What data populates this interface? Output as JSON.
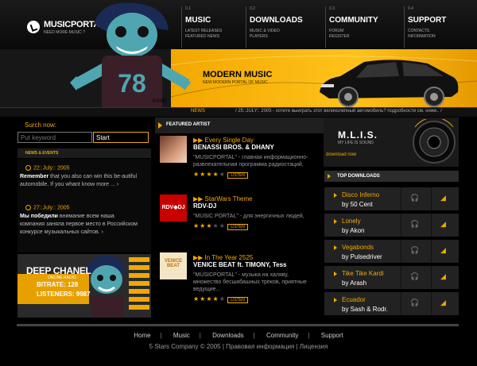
{
  "brand": {
    "name": "MUSICPORTAL",
    "tagline": "NEED MORE MUSIC ?"
  },
  "nav": [
    {
      "num": "0.1",
      "title": "MUSIC",
      "sub1": "LATEST RELEASES",
      "sub2": "FEATURED NEWS"
    },
    {
      "num": "0.2",
      "title": "DOWNLOADS",
      "sub1": "MUSIC & VIDEO",
      "sub2": "PLAYERS"
    },
    {
      "num": "0.3",
      "title": "COMMUNITY",
      "sub1": "FORUM",
      "sub2": "REGISTER"
    },
    {
      "num": "0.4",
      "title": "SUPPORT",
      "sub1": "CONTACTS",
      "sub2": "INFORMATION"
    }
  ],
  "banner": {
    "title": "MODERN MUSIC",
    "subtitle": "NEW MODERN PORTAL OF MUSIC",
    "brand_fragment": "RAND",
    "character_number": "78"
  },
  "news_ticker": {
    "label": "NEWS",
    "text": "/ 25::JULY:: 2005 - хотите выиграть этот великолепный автомобиль? подробности см. ниже.. /"
  },
  "search": {
    "label": "Surch now:",
    "placeholder": "Put keyword",
    "button": "Start"
  },
  "news_events": {
    "heading": "NEWS & EVENTS",
    "items": [
      {
        "date": "22::July:: 2005",
        "bold": "Remember",
        "text": " that you also can win this be-autiful automobile. If you whant know more ...",
        "more": "›"
      },
      {
        "date": "27::July:: 2005",
        "bold": "Мы победили",
        "text": " внимание всем наша компания заняла первое место в Российском конкурсе музыкальных сайтов.",
        "more": "›"
      }
    ]
  },
  "deep_channel": {
    "title": "DEEP CHANEL",
    "sub": "ONLINE RADIO",
    "bitrate": "BITRATE: 128",
    "listeners": "LISTENERS: 9987"
  },
  "featured": {
    "heading": "FEATURED ARTIST",
    "items": [
      {
        "title": "Every Single Day",
        "artist": "BENASSI BROS. & DHANY",
        "desc": "\"MUSICPORTAL\" - главная информационно-развлекательная программа радиостаций,",
        "rating": 4,
        "listen": "LISTEN",
        "img_label": ""
      },
      {
        "title": "StarWars Theme",
        "artist": "RDV-DJ",
        "desc": "\"MUSIC PORTAL\" - для энергичных людей,",
        "rating": 3,
        "listen": "LISTEN",
        "img_label": "RDV◆DJ"
      },
      {
        "title": "In The Year 2525",
        "artist": "VENICE BEAT ft. TIMONY, Tess",
        "desc": "\"MUSICPORTAL\" - музыка на халяву, множество бесшабашных треков, приятные ведущие...",
        "rating": 4,
        "listen": "LISTEN",
        "img_label": "VENICE BEAT"
      }
    ]
  },
  "mlis": {
    "title": "M.L.I.S.",
    "sub": "MY LIFE IS SOUND",
    "link": "download now"
  },
  "top_downloads": {
    "heading": "TOP DOWNLOADS",
    "items": [
      {
        "name": "Disco Inferno",
        "by": "by 50 Cent"
      },
      {
        "name": "Lonely",
        "by": "by Akon"
      },
      {
        "name": "Vegabonds",
        "by": "by Pulsedriver"
      },
      {
        "name": "Tike Tike Kardi",
        "by": "by Arash"
      },
      {
        "name": "Ecuador",
        "by": "by Sash & Rodr."
      }
    ]
  },
  "footer": {
    "links": [
      "Home",
      "Music",
      "Downloads",
      "Community",
      "Support"
    ],
    "copy": "5 Stars Company  ©  2005 | Правовая информация | Лицензия"
  },
  "colors": {
    "accent": "#f2a800",
    "bg": "#000000"
  }
}
